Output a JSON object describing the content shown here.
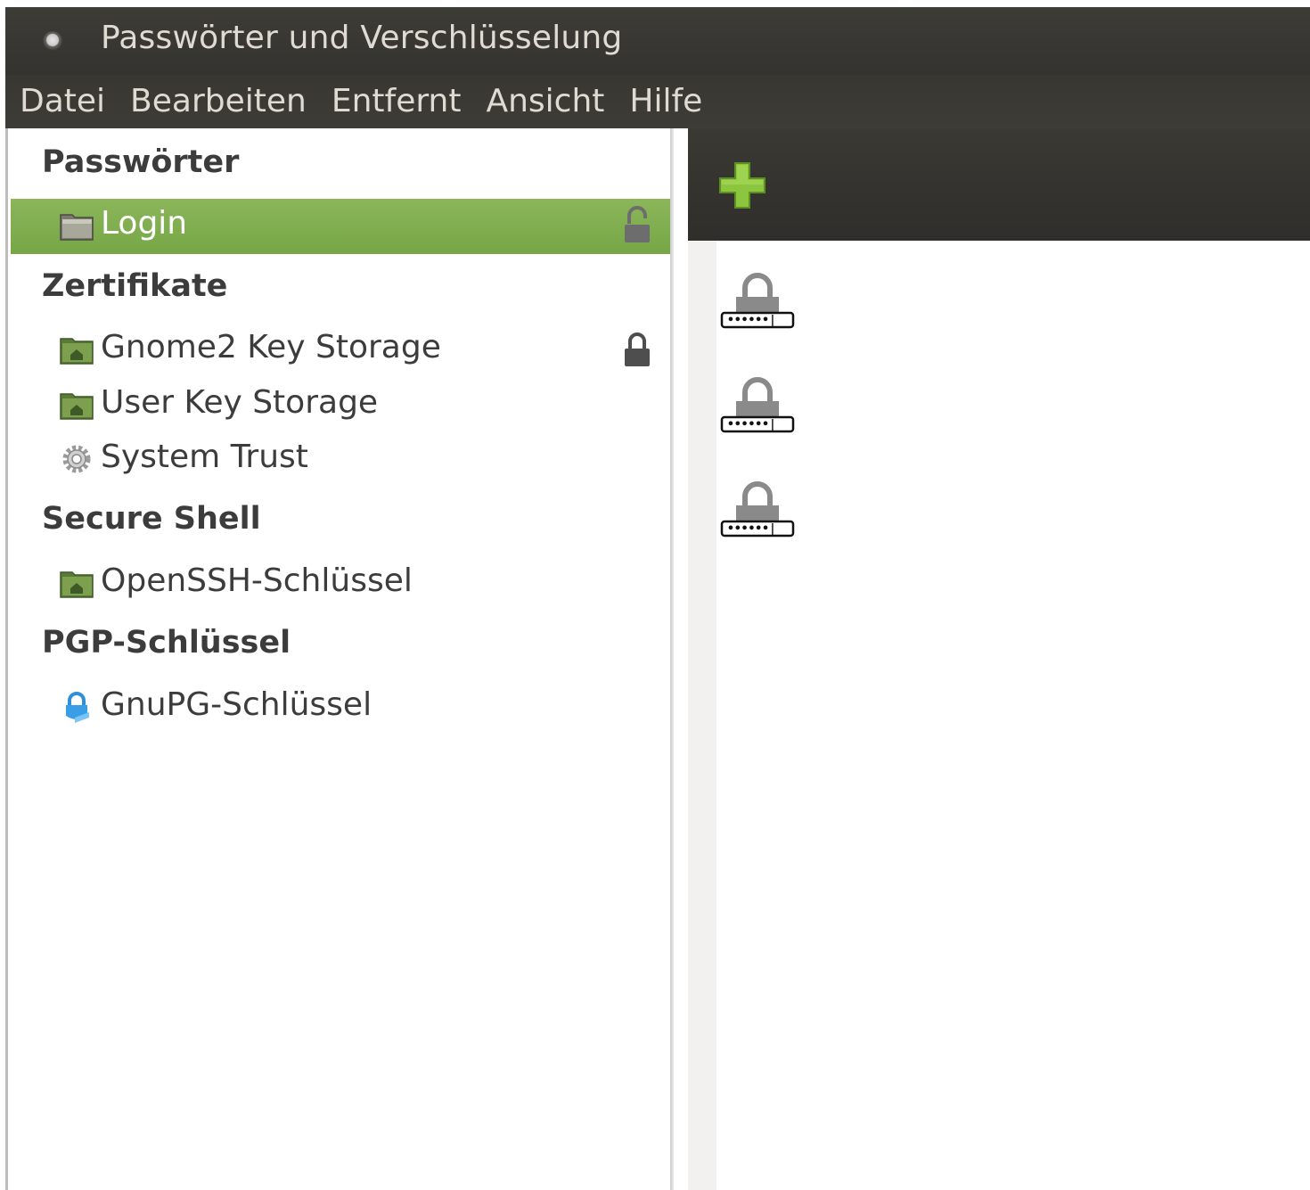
{
  "window": {
    "title": "Passwörter und Verschlüsselung"
  },
  "menu": [
    "Datei",
    "Bearbeiten",
    "Entfernt",
    "Ansicht",
    "Hilfe"
  ],
  "sidebar": {
    "sections": [
      {
        "header": "Passwörter",
        "items": [
          {
            "label": "Login",
            "icon": "folder-icon",
            "selected": true,
            "lock": "unlocked"
          }
        ]
      },
      {
        "header": "Zertifikate",
        "items": [
          {
            "label": "Gnome2 Key Storage",
            "icon": "folder-home-icon",
            "selected": false,
            "lock": "locked"
          },
          {
            "label": "User Key Storage",
            "icon": "folder-home-icon",
            "selected": false,
            "lock": "none"
          },
          {
            "label": "System Trust",
            "icon": "gear-icon",
            "selected": false,
            "lock": "none"
          }
        ]
      },
      {
        "header": "Secure Shell",
        "items": [
          {
            "label": "OpenSSH-Schlüssel",
            "icon": "folder-home-icon",
            "selected": false,
            "lock": "none"
          }
        ]
      },
      {
        "header": "PGP-Schlüssel",
        "items": [
          {
            "label": "GnuPG-Schlüssel",
            "icon": "gnupg-key-icon",
            "selected": false,
            "lock": "none"
          }
        ]
      }
    ]
  },
  "toolbar": {
    "add_icon": "add-icon"
  },
  "key_items": [
    {
      "icon": "password-lock-icon"
    },
    {
      "icon": "password-lock-icon"
    },
    {
      "icon": "password-lock-icon"
    }
  ],
  "colors": {
    "titlebar": "#3c3b37",
    "selection": "#7fae4d",
    "text": "#3c3c3c",
    "menu_text": "#dfdbd2",
    "add_green": "#8cc63f"
  }
}
